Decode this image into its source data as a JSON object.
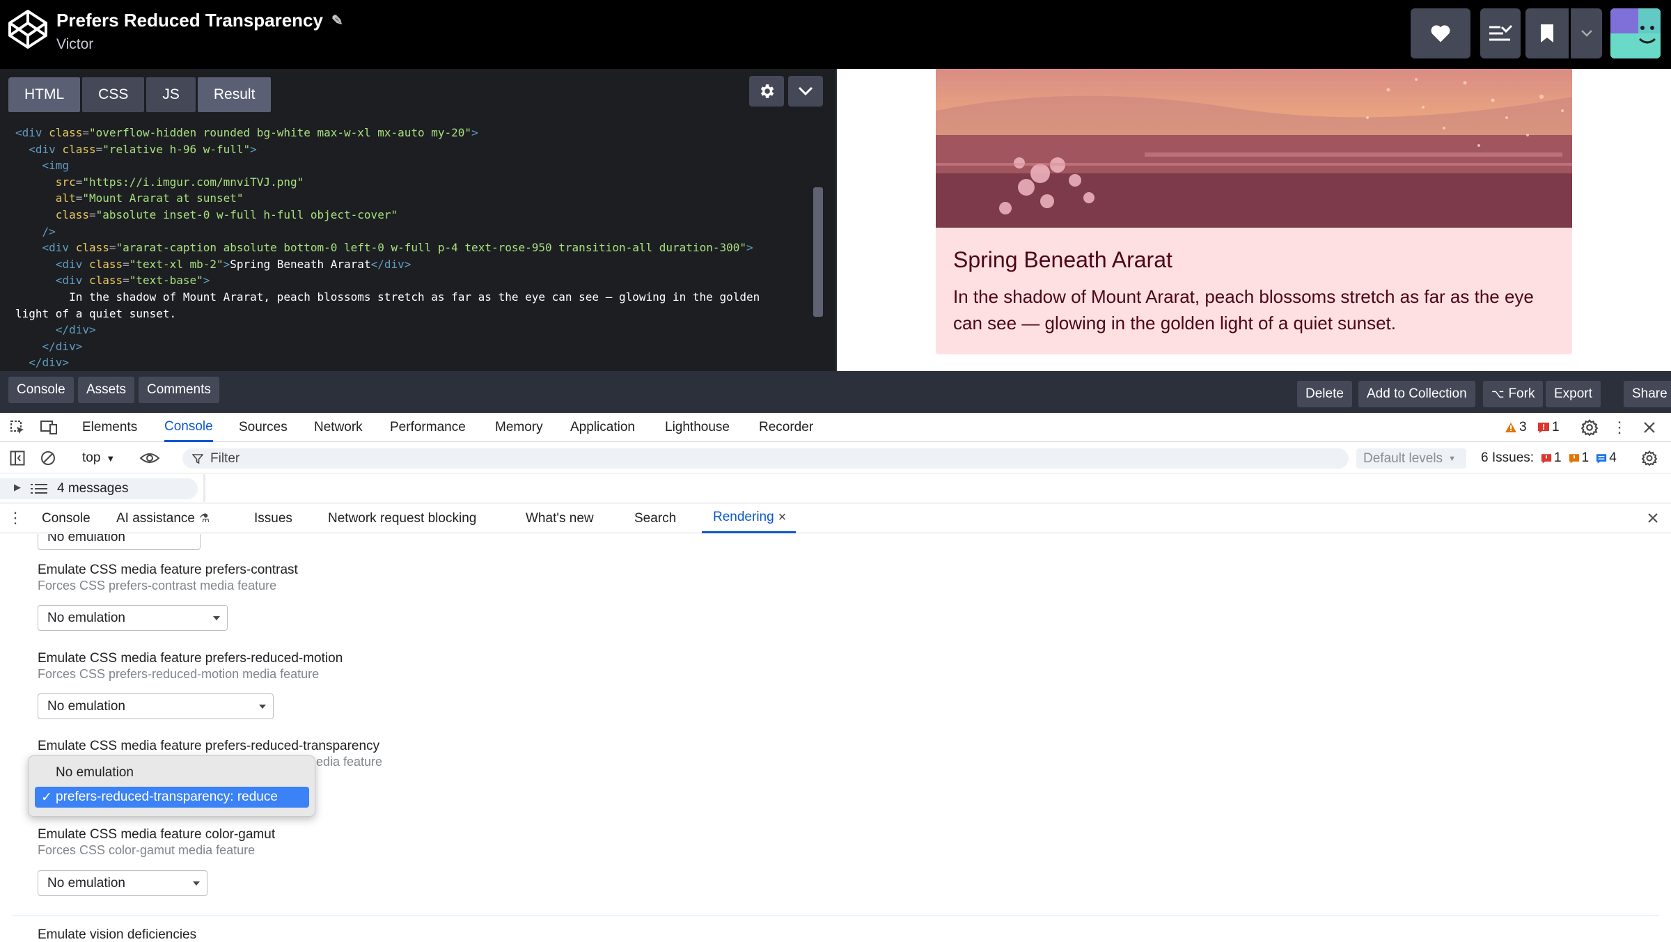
{
  "header": {
    "title": "Prefers Reduced Transparency",
    "author": "Victor"
  },
  "editor": {
    "tabs": [
      "HTML",
      "CSS",
      "JS",
      "Result"
    ],
    "code": {
      "l1_class": "\"overflow-hidden rounded bg-white max-w-xl mx-auto my-20\"",
      "l2_class": "\"relative h-96 w-full\"",
      "l4_src": "\"https://i.imgur.com/mnviTVJ.png\"",
      "l5_alt": "\"Mount Ararat at sunset\"",
      "l6_class": "\"absolute inset-0 w-full h-full object-cover\"",
      "l8_class": "\"ararat-caption absolute bottom-0 left-0 w-full p-4 text-rose-950 transition-all duration-300\"",
      "l9_class": "\"text-xl mb-2\"",
      "l9_text": "Spring Beneath Ararat",
      "l10_class": "\"text-base\"",
      "l11_text": "In the shadow of Mount Ararat, peach blossoms stretch as far as the eye can see — glowing in the golden",
      "l12_text": "light of a quiet sunset."
    }
  },
  "result": {
    "caption_title": "Spring Beneath Ararat",
    "caption_text": "In the shadow of Mount Ararat, peach blossoms stretch as far as the eye can see — glowing in the golden light of a quiet sunset."
  },
  "bottom_bar": {
    "left": [
      "Console",
      "Assets",
      "Comments"
    ],
    "right": [
      "Delete",
      "Add to Collection",
      "Fork",
      "Export",
      "Share"
    ]
  },
  "devtools": {
    "tabs": [
      "Elements",
      "Console",
      "Sources",
      "Network",
      "Performance",
      "Memory",
      "Application",
      "Lighthouse",
      "Recorder"
    ],
    "active_tab": "Console",
    "warn_count": "3",
    "error_count": "1",
    "context": "top",
    "filter_placeholder": "Filter",
    "levels": "Default levels",
    "issues_label": "6 Issues:",
    "issues_counts": [
      "1",
      "1",
      "4"
    ],
    "messages": "4 messages",
    "drawer_tabs": [
      "Console",
      "AI assistance",
      "Issues",
      "Network request blocking",
      "What's new",
      "Search",
      "Rendering"
    ],
    "active_drawer_tab": "Rendering"
  },
  "rendering": {
    "cut_select": "No emulation",
    "sections": [
      {
        "title": "Emulate CSS media feature prefers-contrast",
        "sub": "Forces CSS prefers-contrast media feature",
        "value": "No emulation"
      },
      {
        "title": "Emulate CSS media feature prefers-reduced-motion",
        "sub": "Forces CSS prefers-reduced-motion media feature",
        "value": "No emulation"
      },
      {
        "title": "Emulate CSS media feature prefers-reduced-transparency",
        "sub": "media feature",
        "value": "prefers-reduced-transparency: reduce"
      },
      {
        "title": "Emulate CSS media feature color-gamut",
        "sub": "Forces CSS color-gamut media feature",
        "value": "No emulation"
      }
    ],
    "vision_title": "Emulate vision deficiencies",
    "popup_options": [
      "No emulation",
      "prefers-reduced-transparency: reduce"
    ]
  },
  "colors": {
    "accent": "#0b57d0",
    "caption_bg": "#ffe0e2",
    "caption_text": "#4c0519",
    "codepen_bar": "#444857"
  }
}
